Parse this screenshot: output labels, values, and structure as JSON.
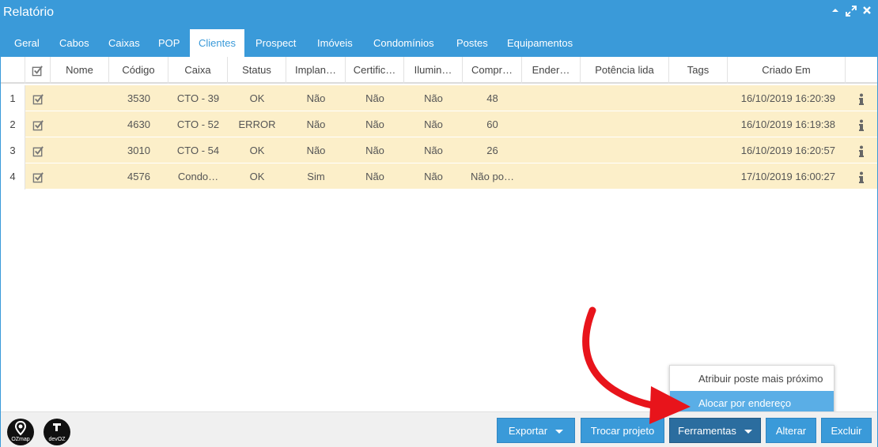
{
  "window": {
    "title": "Relatório"
  },
  "tabs": [
    "Geral",
    "Cabos",
    "Caixas",
    "POP",
    "Clientes",
    "Prospect",
    "Imóveis",
    "Condomínios",
    "Postes",
    "Equipamentos"
  ],
  "active_tab": "Clientes",
  "columns": {
    "nome": "Nome",
    "codigo": "Código",
    "caixa": "Caixa",
    "status": "Status",
    "implantado": "Implan…",
    "certificado": "Certific…",
    "iluminado": "Ilumin…",
    "comprimento": "Compr…",
    "endereco": "Ender…",
    "potencia": "Potência lida",
    "tags": "Tags",
    "criado": "Criado Em"
  },
  "rows": [
    {
      "num": "1",
      "codigo": "3530",
      "caixa": "CTO - 39",
      "status": "OK",
      "implantado": "Não",
      "certificado": "Não",
      "iluminado": "Não",
      "comprimento": "48",
      "criado": "16/10/2019 16:20:39"
    },
    {
      "num": "2",
      "codigo": "4630",
      "caixa": "CTO - 52",
      "status": "ERROR",
      "implantado": "Não",
      "certificado": "Não",
      "iluminado": "Não",
      "comprimento": "60",
      "criado": "16/10/2019 16:19:38"
    },
    {
      "num": "3",
      "codigo": "3010",
      "caixa": "CTO - 54",
      "status": "OK",
      "implantado": "Não",
      "certificado": "Não",
      "iluminado": "Não",
      "comprimento": "26",
      "criado": "16/10/2019 16:20:57"
    },
    {
      "num": "4",
      "codigo": "4576",
      "caixa": "Condo…",
      "status": "OK",
      "implantado": "Sim",
      "certificado": "Não",
      "iluminado": "Não",
      "comprimento": "Não po…",
      "criado": "17/10/2019 16:00:27"
    }
  ],
  "dropdown": {
    "items": [
      "Atribuir poste mais próximo",
      "Alocar por endereço"
    ],
    "selected": "Alocar por endereço"
  },
  "buttons": {
    "exportar": "Exportar",
    "trocar": "Trocar projeto",
    "ferramentas": "Ferramentas",
    "alterar": "Alterar",
    "excluir": "Excluir"
  },
  "logos": {
    "oz_map": "OZmap",
    "dev_oz": "devOZ"
  },
  "colors": {
    "primary": "#3a9ad9",
    "row_highlight": "#fcefc9",
    "arrow": "#e8141b"
  },
  "icons": [
    "checkbox-checked-icon",
    "info-icon",
    "caret-down-icon",
    "collapse-icon",
    "maximize-icon",
    "close-icon",
    "map-pin-icon"
  ]
}
